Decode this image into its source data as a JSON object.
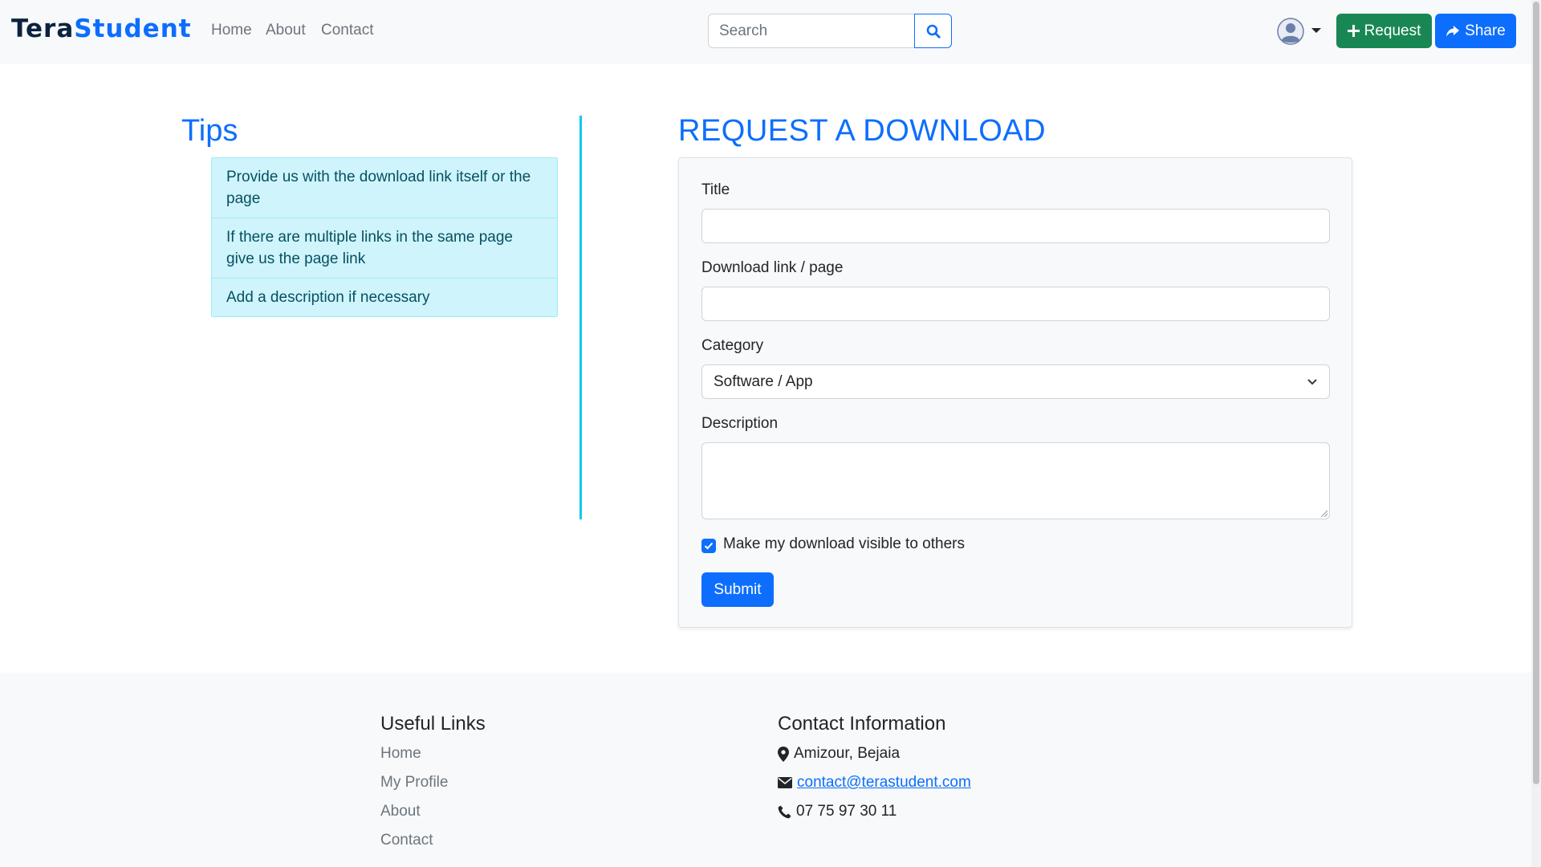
{
  "navbar": {
    "brand_prefix": "Tera",
    "brand_suffix": "Student",
    "links": [
      "Home",
      "About",
      "Contact"
    ],
    "search_placeholder": "Search",
    "request_label": "Request",
    "share_label": "Share"
  },
  "tips": {
    "title": "Tips",
    "items": [
      "Provide us with the download link itself or the page",
      "If there are multiple links in the same page give us the page link",
      "Add a description if necessary"
    ]
  },
  "form": {
    "title": "REQUEST A DOWNLOAD",
    "title_label": "Title",
    "link_label": "Download link / page",
    "category_label": "Category",
    "category_value": "Software / App",
    "description_label": "Description",
    "visible_label": "Make my download visible to others",
    "visible_checked": true,
    "submit_label": "Submit"
  },
  "footer": {
    "links_title": "Useful Links",
    "links": [
      "Home",
      "My Profile",
      "About",
      "Contact"
    ],
    "contact_title": "Contact Information",
    "address": "Amizour, Bejaia",
    "email": "contact@terastudent.com",
    "phone": "07 75 97 30 11"
  },
  "colors": {
    "primary": "#0d6efd",
    "success": "#198754",
    "info_bg": "#cff4fc",
    "info_text": "#055160",
    "divider": "#0dcaf0"
  }
}
